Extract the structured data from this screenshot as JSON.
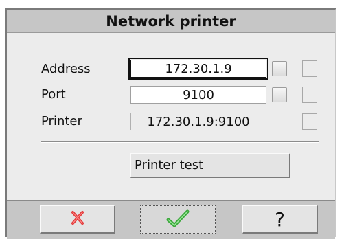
{
  "window": {
    "title": "Network printer"
  },
  "form": {
    "address": {
      "label": "Address",
      "value": "172.30.1.9"
    },
    "port": {
      "label": "Port",
      "value": "9100"
    },
    "printer": {
      "label": "Printer",
      "value": "172.30.1.9:9100"
    }
  },
  "actions": {
    "test_label": "Printer test"
  },
  "footer": {
    "cancel_icon": "red-x-icon",
    "ok_icon": "green-checkmark-icon",
    "help_label": "?"
  },
  "colors": {
    "cancel": "#e23b3b",
    "ok": "#4cc24c",
    "titlebar": "#c6c6c6"
  }
}
